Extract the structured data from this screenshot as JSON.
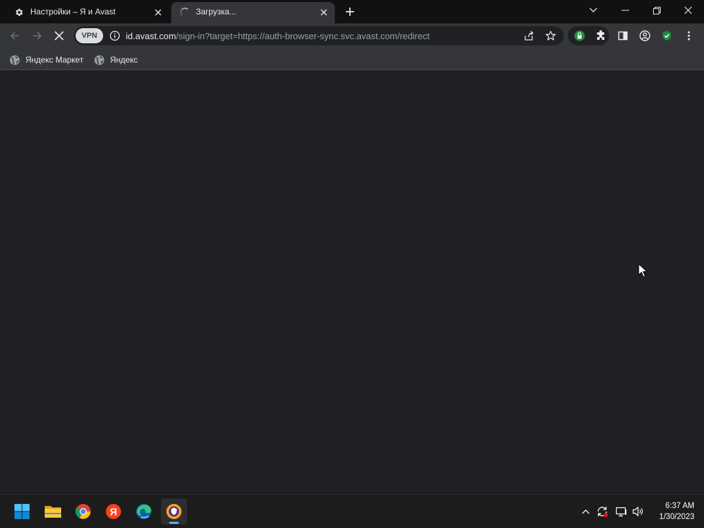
{
  "browser": {
    "tabs": [
      {
        "title": "Настройки – Я и Avast",
        "icon": "gear-icon",
        "state": "inactive"
      },
      {
        "title": "Загрузка...",
        "icon": "loading-spinner-icon",
        "state": "active"
      }
    ],
    "toolbar": {
      "vpn_label": "VPN",
      "url_host": "id.avast.com",
      "url_path": "/sign-in?target=https://auth-browser-sync.svc.avast.com/redirect"
    },
    "bookmarks": [
      {
        "label": "Яндекс Маркет",
        "icon": "globe-icon"
      },
      {
        "label": "Яндекс",
        "icon": "globe-icon"
      }
    ]
  },
  "taskbar": {
    "apps": [
      {
        "name": "Start",
        "icon": "windows-start-icon"
      },
      {
        "name": "File Explorer",
        "icon": "folder-icon"
      },
      {
        "name": "Google Chrome",
        "icon": "chrome-icon"
      },
      {
        "name": "Yandex Browser",
        "icon": "yandex-icon"
      },
      {
        "name": "Microsoft Edge",
        "icon": "edge-icon"
      },
      {
        "name": "Avast Secure Browser",
        "icon": "avast-browser-icon",
        "active": true
      }
    ],
    "clock": {
      "time": "6:37 AM",
      "date": "1/30/2023"
    }
  },
  "colors": {
    "content_bg": "#1f2023",
    "toolbar_bg": "#35363a",
    "tabstrip_bg": "#111111",
    "taskbar_bg": "#1c1c1c",
    "extension_green": "#1e8e3e"
  }
}
